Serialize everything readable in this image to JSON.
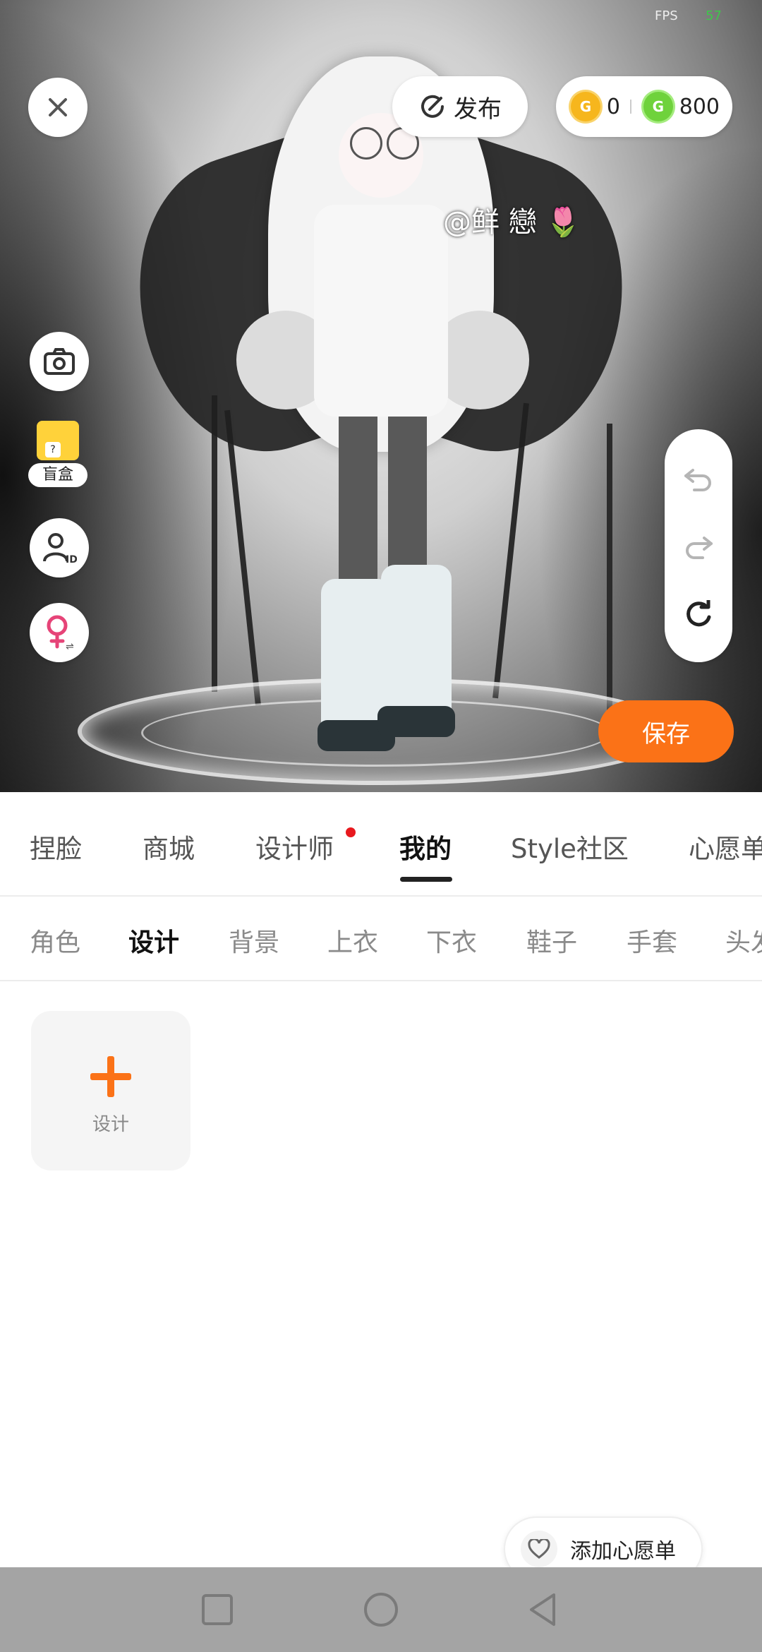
{
  "status": {
    "fps_label": "FPS",
    "fps_value": "57"
  },
  "scene": {
    "watermark": "@鲜 戀 🌷"
  },
  "topbar": {
    "publish_label": "发布",
    "coins": {
      "gold_value": "0",
      "green_value": "800",
      "gold_symbol": "G",
      "green_symbol": "G"
    }
  },
  "left_tools": {
    "blindbox_label": "盲盒",
    "blindbox_question": "?"
  },
  "save_label": "保存",
  "tabs": [
    {
      "label": "捏脸"
    },
    {
      "label": "商城"
    },
    {
      "label": "设计师"
    },
    {
      "label": "我的"
    },
    {
      "label": "Style社区"
    },
    {
      "label": "心愿单"
    }
  ],
  "subtabs": [
    {
      "label": "角色"
    },
    {
      "label": "设计"
    },
    {
      "label": "背景"
    },
    {
      "label": "上衣"
    },
    {
      "label": "下衣"
    },
    {
      "label": "鞋子"
    },
    {
      "label": "手套"
    },
    {
      "label": "头发"
    }
  ],
  "design_card": {
    "label": "设计"
  },
  "wishlist": {
    "label": "添加心愿单"
  },
  "colors": {
    "accent": "#fb7217",
    "notification_dot": "#e8191e",
    "gold_coin": "#f6b61d",
    "green_coin": "#6fd23c"
  }
}
